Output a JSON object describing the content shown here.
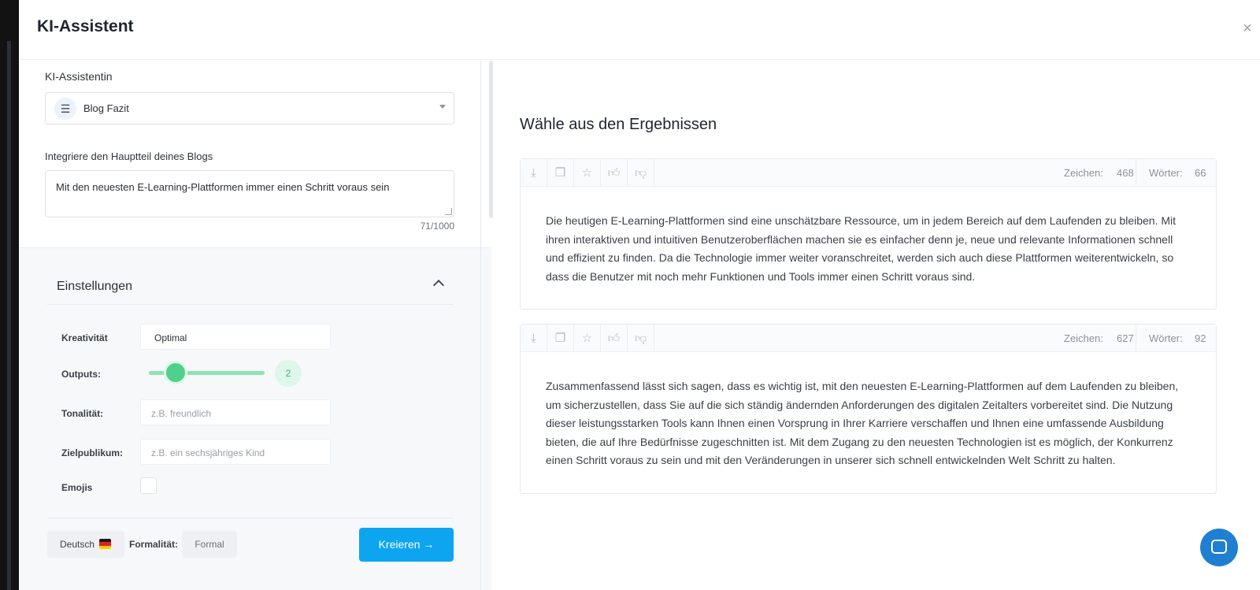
{
  "modal": {
    "title": "KI-Assistent",
    "close_label": "×"
  },
  "assistant": {
    "label": "KI-Assistentin",
    "selected": "Blog Fazit",
    "icon": "list-icon"
  },
  "blog_input": {
    "label": "Integriere den Hauptteil deines Blogs",
    "value": "Mit den neuesten E-Learning-Plattformen immer einen Schritt voraus sein",
    "counter": "71/1000"
  },
  "settings": {
    "title": "Einstellungen",
    "kreativitaet_label": "Kreativität",
    "kreativitaet_value": "Optimal",
    "outputs_label": "Outputs:",
    "outputs_value": "2",
    "tonalitaet_label": "Tonalität:",
    "tonalitaet_placeholder": "z.B. freundlich",
    "zielpublikum_label": "Zielpublikum:",
    "zielpublikum_placeholder": "z.B. ein sechsjähriges Kind",
    "emojis_label": "Emojis"
  },
  "footer": {
    "language": "Deutsch",
    "formality_label": "Formalität:",
    "formality_value": "Formal",
    "create_label": "Kreieren →"
  },
  "results": {
    "title": "Wähle aus den Ergebnissen",
    "chars_label": "Zeichen:",
    "words_label": "Wörter:",
    "items": [
      {
        "chars": "468",
        "words": "66",
        "text": "Die heutigen E-Learning-Plattformen sind eine unschätzbare Ressource, um in jedem Bereich auf dem Laufenden zu bleiben. Mit ihren interaktiven und intuitiven Benutzeroberflächen machen sie es einfacher denn je, neue und relevante Informationen schnell und effizient zu finden. Da die Technologie immer weiter voranschreitet, werden sich auch diese Plattformen weiterentwickeln, so dass die Benutzer mit noch mehr Funktionen und Tools immer einen Schritt voraus sind."
      },
      {
        "chars": "627",
        "words": "92",
        "text": "Zusammenfassend lässt sich sagen, dass es wichtig ist, mit den neuesten E-Learning-Plattformen auf dem Laufenden zu bleiben, um sicherzustellen, dass Sie auf die sich ständig ändernden Anforderungen des digitalen Zeitalters vorbereitet sind. Die Nutzung dieser leistungsstarken Tools kann Ihnen einen Vorsprung in Ihrer Karriere verschaffen und Ihnen eine umfassende Ausbildung bieten, die auf Ihre Bedürfnisse zugeschnitten ist. Mit dem Zugang zu den neuesten Technologien ist es möglich, der Konkurrenz einen Schritt voraus zu sein und mit den Veränderungen in unserer sich schnell entwickelnden Welt Schritt zu halten."
      }
    ]
  },
  "colors": {
    "accent": "#0ea5f0",
    "slider": "#4fd18b"
  }
}
